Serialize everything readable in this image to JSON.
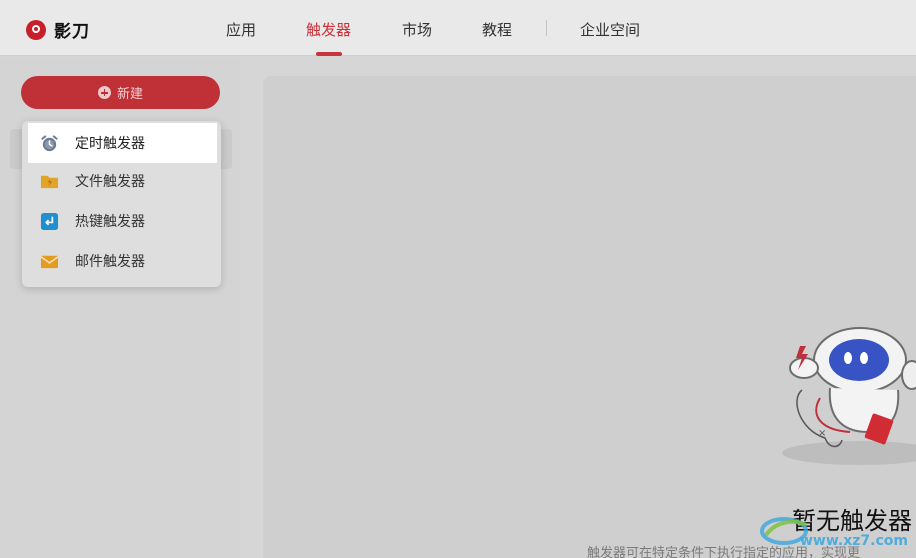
{
  "app": {
    "title": "影刀"
  },
  "nav": {
    "items": [
      {
        "label": "应用",
        "active": false
      },
      {
        "label": "触发器",
        "active": true
      },
      {
        "label": "市场",
        "active": false
      },
      {
        "label": "教程",
        "active": false
      },
      {
        "label": "企业空间",
        "active": false
      }
    ]
  },
  "sidebar": {
    "new_button_label": "新建"
  },
  "dropdown": {
    "items": [
      {
        "label": "定时触发器",
        "icon": "alarm-clock-icon"
      },
      {
        "label": "文件触发器",
        "icon": "folder-bolt-icon"
      },
      {
        "label": "热键触发器",
        "icon": "hotkey-icon"
      },
      {
        "label": "邮件触发器",
        "icon": "mail-icon"
      }
    ]
  },
  "empty_state": {
    "title": "暂无触发器",
    "description": "触发器可在特定条件下执行指定的应用，实现更"
  },
  "watermark": {
    "text": "www.xz7.com"
  },
  "colors": {
    "accent": "#c9333b",
    "button": "#c03037"
  }
}
